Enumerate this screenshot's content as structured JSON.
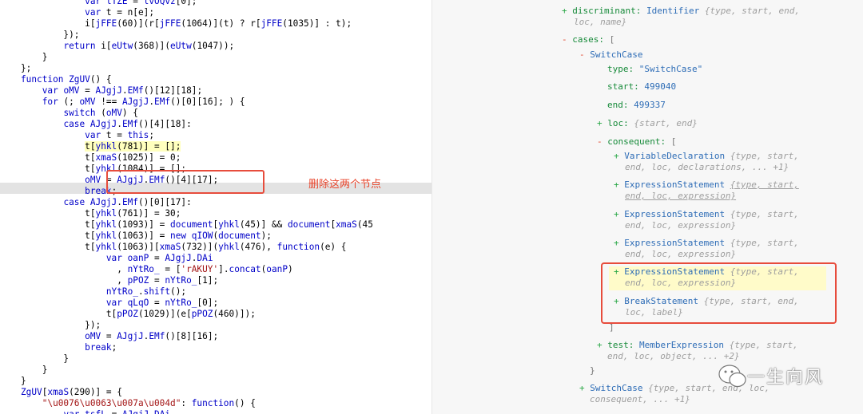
{
  "code": {
    "lines": [
      "            var lTZE = lvOQvz[0];",
      "            var t = n[e];",
      "            i[jFFE(60)](r[jFFE(1064)](t) ? r[jFFE(1035)] : t);",
      "        });",
      "        return i[eUtw(368)](eUtw(1047));",
      "    }",
      "};",
      "function ZgUV() {",
      "    var oMV = AJgjJ.EMf()[12][18];",
      "    for (; oMV !== AJgjJ.EMf()[0][16]; ) {",
      "        switch (oMV) {",
      "        case AJgjJ.EMf()[4][18]:",
      "            var t = this;",
      "            t[yhkl(781)] = [];",
      "            t[xmaS(1025)] = 0;",
      "            t[yhkl(1084)] = [];",
      "            oMV = AJgjJ.EMf()[4][17];",
      "            break;",
      "        case AJgjJ.EMf()[0][17]:",
      "            t[yhkl(761)] = 30;",
      "            t[yhkl(1093)] = document[yhkl(45)] && document[xmaS(45",
      "            t[yhkl(1063)] = new qIOW(document);",
      "            t[yhkl(1063)][xmaS(732)](yhkl(476), function(e) {",
      "                var oanP = AJgjJ.DAi",
      "                  , nYtRo_ = ['rAKUY'].concat(oanP)",
      "                  , pPOZ = nYtRo_[1];",
      "                nYtRo_.shift();",
      "                var qLqO = nYtRo_[0];",
      "                t[pPOZ(1029)](e[pPOZ(460)]);",
      "            });",
      "            oMV = AJgjJ.EMf()[8][16];",
      "            break;",
      "        }",
      "    }",
      "}",
      "ZgUV[xmaS(290)] = {",
      "    \"\\u0076\\u0063\\u007a\\u004d\": function() {",
      "        var tsfL = AJgjJ.DAi"
    ],
    "annotation": "删除这两个节点"
  },
  "ast": {
    "discriminant": {
      "toggle": "+",
      "key": "discriminant:",
      "type": "Identifier",
      "meta1": "{type, start, end,",
      "meta2": "loc, name}"
    },
    "cases": {
      "toggle": "-",
      "key": "cases:",
      "bracket": "["
    },
    "switchcase": {
      "toggle": "-",
      "type": "SwitchCase"
    },
    "type_row": {
      "key": "type:",
      "value": "\"SwitchCase\""
    },
    "start_row": {
      "key": "start:",
      "value": "499040"
    },
    "end_row": {
      "key": "end:",
      "value": "499337"
    },
    "loc_row": {
      "toggle": "+",
      "key": "loc:",
      "meta": "{start, end}"
    },
    "consequent": {
      "toggle": "-",
      "key": "consequent:",
      "bracket": "["
    },
    "items": [
      {
        "toggle": "+",
        "type": "VariableDeclaration",
        "meta1": "{type, start,",
        "meta2": "end, loc, declarations, ... +1}"
      },
      {
        "toggle": "+",
        "type": "ExpressionStatement",
        "meta1": "{type, start,",
        "meta2": "end, loc, expression}"
      },
      {
        "toggle": "+",
        "type": "ExpressionStatement",
        "meta1": "{type, start,",
        "meta2": "end, loc, expression}"
      },
      {
        "toggle": "+",
        "type": "ExpressionStatement",
        "meta1": "{type, start,",
        "meta2": "end, loc, expression}"
      },
      {
        "toggle": "+",
        "type": "ExpressionStatement",
        "meta1": "{type, start,",
        "meta2": "end, loc, expression}"
      },
      {
        "toggle": "+",
        "type": "BreakStatement",
        "meta1": "{type, start, end,",
        "meta2": "loc, label}"
      }
    ],
    "close_bracket": "]",
    "test_row": {
      "toggle": "+",
      "key": "test:",
      "type": "MemberExpression",
      "meta1": "{type, start,",
      "meta2": "end, loc, object, ... +2}"
    },
    "close_brace": "}",
    "switchcase2": {
      "toggle": "+",
      "type": "SwitchCase",
      "meta1": "{type, start, end, loc,",
      "meta2": "consequent, ... +1}"
    }
  },
  "watermark": {
    "text": "一生向风"
  },
  "colors": {
    "marker": "#e74c3c",
    "keyword": "#0000c8",
    "string": "#a31515",
    "ast_key": "#168a39",
    "ast_type": "#2d6cb6"
  }
}
